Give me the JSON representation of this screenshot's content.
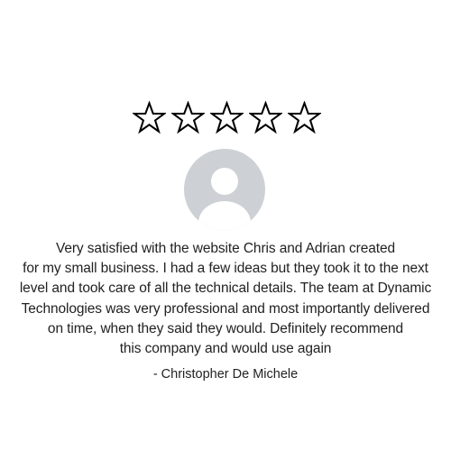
{
  "rating": {
    "max_stars": 5,
    "filled_stars": 0,
    "star_icon": "star-outline-icon"
  },
  "reviewer": {
    "avatar_icon": "default-user-avatar-icon",
    "avatar_color": "#cdd0d4"
  },
  "review": {
    "lines": [
      "Very satisfied with the website Chris and Adrian created",
      "for my small business. I had a few ideas but they took it to the next",
      "level and took care of all the technical details. The team at Dynamic",
      "Technologies was very professional and most importantly delivered",
      "on time, when they said they would. Definitely recommend",
      "this company and would use again"
    ],
    "author": "- Christopher De Michele"
  },
  "colors": {
    "text": "#222222",
    "star_stroke": "#000000",
    "background": "#ffffff"
  }
}
